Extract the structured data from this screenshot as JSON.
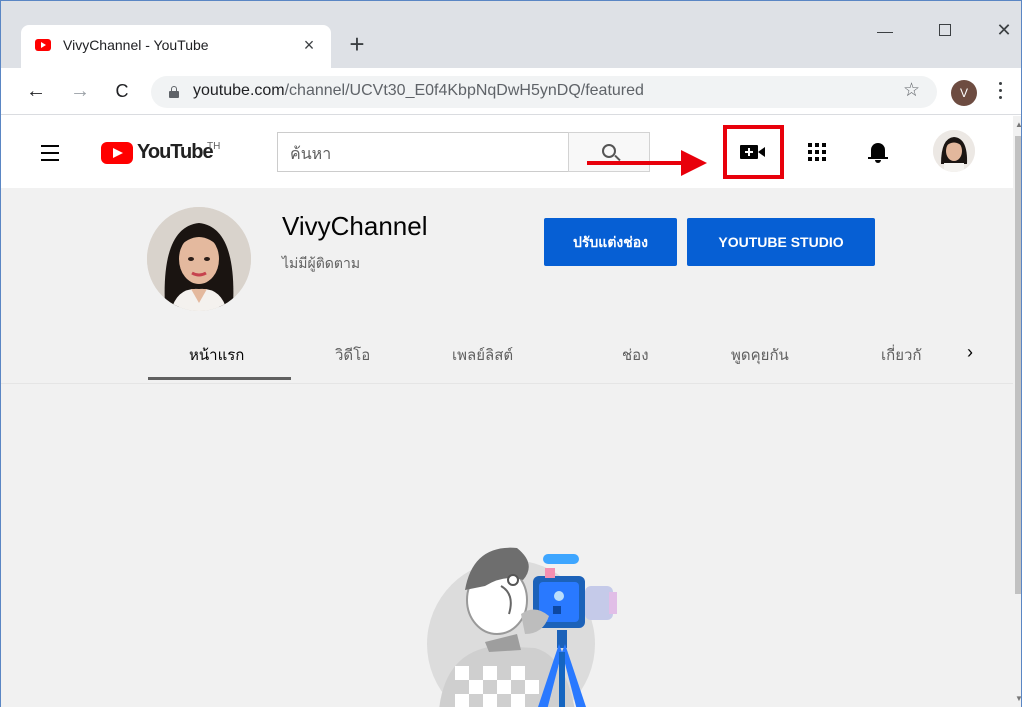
{
  "browser": {
    "tab_title": "VivyChannel - YouTube",
    "tab_close": "×",
    "new_tab": "+",
    "window_close": "✕",
    "url_host": "youtube.com",
    "url_path": "/channel/UCVt30_E0f4KbpNqDwH5ynDQ/featured",
    "profile_initial": "V",
    "back": "←",
    "forward": "→",
    "reload": "C",
    "star": "☆"
  },
  "youtube": {
    "region": "TH",
    "logo_text": "YouTube",
    "search_placeholder": "ค้นหา",
    "channel": {
      "name": "VivyChannel",
      "subscribers": "ไม่มีผู้ติดตาม",
      "customize_label": "ปรับแต่งช่อง",
      "studio_label": "YOUTUBE STUDIO"
    },
    "tabs": [
      "หน้าแรก",
      "วิดีโอ",
      "เพลย์ลิสต์",
      "ช่อง",
      "พูดคุยกัน",
      "เกี่ยวกั"
    ],
    "active_tab": "หน้าแรก",
    "tabs_more": "›"
  },
  "annotation": {
    "highlight_color": "#e8000b",
    "target": "create-video-icon"
  },
  "colors": {
    "accent_blue": "#065fd4",
    "yt_red": "#ff0000",
    "page_bg": "#f1f1f1"
  }
}
